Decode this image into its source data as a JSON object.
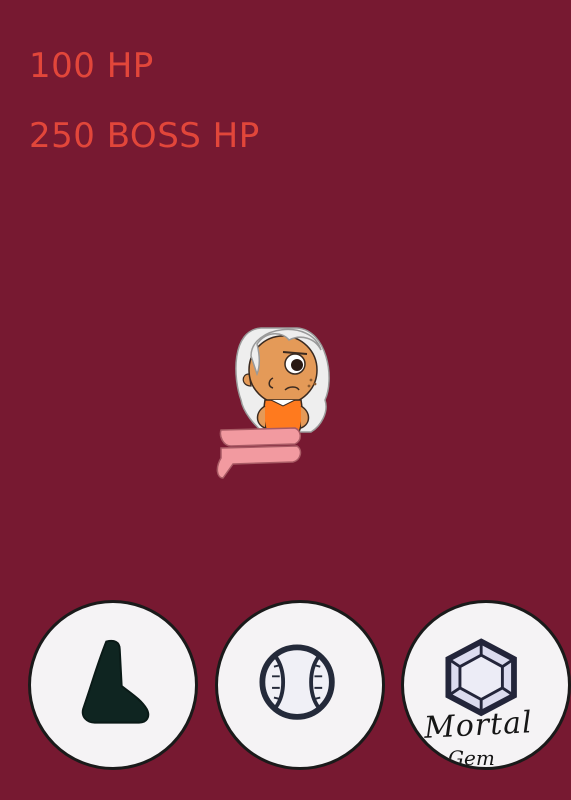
{
  "hud": {
    "player_hp": "100 HP",
    "boss_hp": "250 BOSS HP"
  },
  "colors": {
    "background": "#771931",
    "hud_text": "#e2463a",
    "button_fill": "#f5f3f5"
  },
  "actions": {
    "gem_label": "Mortal",
    "gem_sublabel": "Gem"
  },
  "icons": {
    "boot": "boot-icon",
    "ball": "baseball-icon",
    "gem": "gem-icon"
  }
}
